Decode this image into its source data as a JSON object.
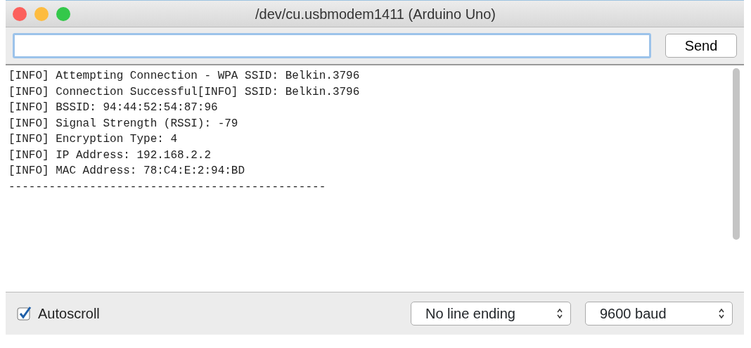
{
  "window": {
    "title": "/dev/cu.usbmodem1411 (Arduino Uno)"
  },
  "input": {
    "send_label": "Send"
  },
  "output_lines": [
    "[INFO] Attempting Connection - WPA SSID: Belkin.3796",
    "[INFO] Connection Successful[INFO] SSID: Belkin.3796",
    "[INFO] BSSID: 94:44:52:54:87:96",
    "[INFO] Signal Strength (RSSI): -79",
    "[INFO] Encryption Type: 4",
    "[INFO] IP Address: 192.168.2.2",
    "[INFO] MAC Address: 78:C4:E:2:94:BD",
    "-----------------------------------------------"
  ],
  "autoscroll": {
    "label": "Autoscroll",
    "checked": true
  },
  "line_ending": {
    "value": "No line ending"
  },
  "baud": {
    "value": "9600 baud"
  }
}
